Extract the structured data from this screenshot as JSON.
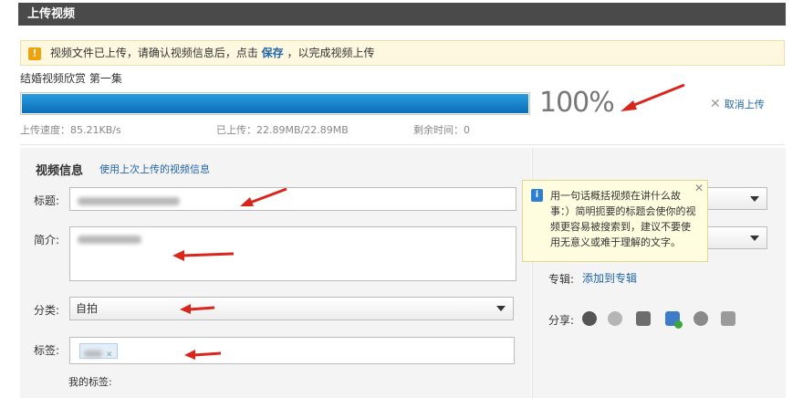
{
  "header": {
    "title": "上传视频"
  },
  "notice": {
    "prefix": "视频文件已上传，请确认视频信息后，点击",
    "link": "保存",
    "suffix": "，以完成视频上传"
  },
  "upload": {
    "video_name": "结婚视频欣赏 第一集",
    "progress_fraction": 1.0,
    "percent_label": "100%",
    "cancel_label": "取消上传",
    "speed": "上传速度：85.21KB/s",
    "uploaded": "已上传：22.89MB/22.89MB",
    "remaining": "剩余时间：0"
  },
  "form": {
    "section_title": "视频信息",
    "reuse_link": "使用上次上传的视频信息",
    "title_label": "标题:",
    "intro_label": "简介:",
    "category_label": "分类:",
    "category_value": "自拍",
    "tags_label": "标签:",
    "my_tags_label": "我的标签:"
  },
  "tooltip": {
    "text": "用一句话概括视频在讲什么故事：）简明扼要的标题会使你的视频更容易被搜索到，建议不要使用无意义或难于理解的文字。"
  },
  "sidebar": {
    "album_label": "专辑:",
    "album_link": "添加到专辑",
    "share_label": "分享:"
  },
  "colors": {
    "progress": "#0a7ccc",
    "header": "#4a4a4a",
    "link": "#2266aa",
    "arrow": "#d8261c"
  },
  "icons": [
    "warning-icon",
    "info-icon",
    "close-icon",
    "cancel-x-icon",
    "chevron-down-icon",
    "share-icons"
  ]
}
